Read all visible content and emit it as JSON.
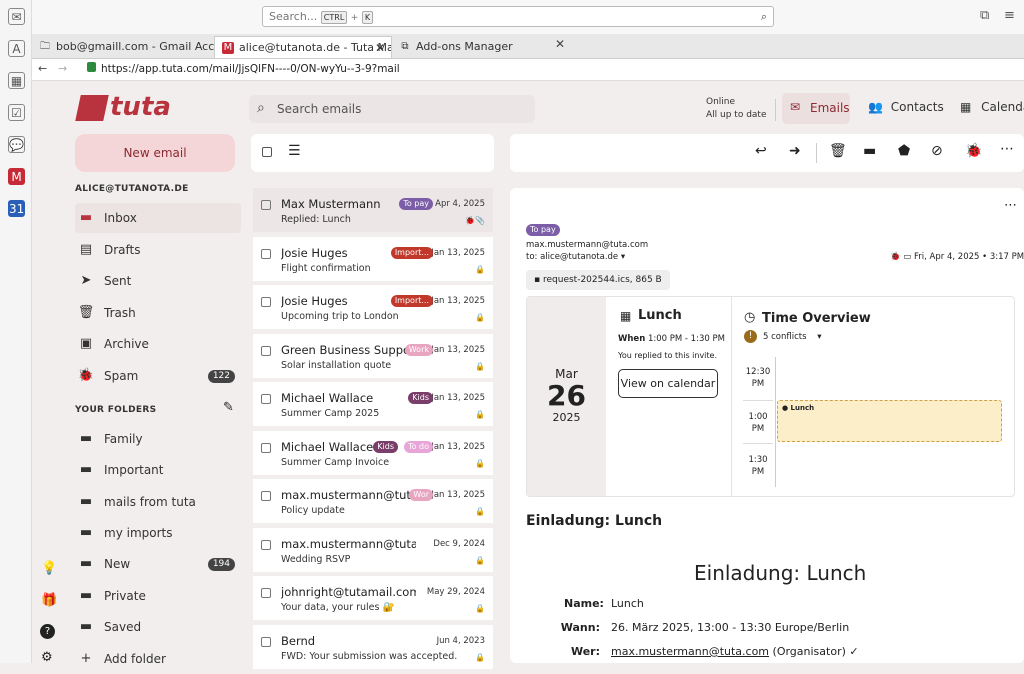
{
  "browser": {
    "search_placeholder": "Search...",
    "search_key1": "CTRL",
    "search_plus": "+",
    "search_key2": "K",
    "tabs": [
      {
        "label": "bob@gmaill.com - Gmail Accou"
      },
      {
        "label": "alice@tutanota.de - Tuta Ma"
      },
      {
        "label": "Add-ons Manager"
      }
    ],
    "url": "https://app.tuta.com/mail/JjsQlFN----0/ON-wyYu--3-9?mail"
  },
  "app": {
    "logo": "tuta",
    "search_placeholder": "Search emails",
    "status_line1": "Online",
    "status_line2": "All up to date",
    "nav": {
      "emails": "Emails",
      "contacts": "Contacts",
      "calendar": "Calendar"
    },
    "new_email": "New email",
    "account": "ALICE@TUTANOTA.DE",
    "folders": [
      {
        "label": "Inbox",
        "icon": "inbox-icon"
      },
      {
        "label": "Drafts",
        "icon": "drafts-icon"
      },
      {
        "label": "Sent",
        "icon": "sent-icon"
      },
      {
        "label": "Trash",
        "icon": "trash-icon"
      },
      {
        "label": "Archive",
        "icon": "archive-icon"
      },
      {
        "label": "Spam",
        "icon": "spam-icon",
        "count": "122"
      }
    ],
    "your_folders": "YOUR FOLDERS",
    "custom_folders": [
      {
        "label": "Family"
      },
      {
        "label": "Important"
      },
      {
        "label": "mails from tuta"
      },
      {
        "label": "my imports"
      },
      {
        "label": "New",
        "count": "194"
      },
      {
        "label": "Private"
      },
      {
        "label": "Saved"
      }
    ],
    "add_folder": "Add folder"
  },
  "emails": [
    {
      "sender": "Max Mustermann",
      "subject": "Replied: Lunch",
      "date": "Apr 4, 2025",
      "labels": [
        {
          "text": "To pay",
          "color": "#7b5ea7"
        }
      ],
      "icons": "🐞📎"
    },
    {
      "sender": "Josie Huges",
      "subject": "Flight confirmation",
      "date": "Jan 13, 2025",
      "labels": [
        {
          "text": "Import...",
          "color": "#c0392b"
        }
      ],
      "icons": "🔒"
    },
    {
      "sender": "Josie Huges",
      "subject": "Upcoming trip to London",
      "date": "Jan 13, 2025",
      "labels": [
        {
          "text": "Import...",
          "color": "#c0392b"
        }
      ],
      "icons": "🔒"
    },
    {
      "sender": "Green Business Support",
      "subject": "Solar installation quote",
      "date": "Jan 13, 2025",
      "labels": [
        {
          "text": "Work",
          "color": "#e8a5c0"
        }
      ],
      "icons": "🔒"
    },
    {
      "sender": "Michael Wallace",
      "subject": "Summer Camp 2025",
      "date": "Jan 13, 2025",
      "labels": [
        {
          "text": "Kids",
          "color": "#7a3e6a"
        }
      ],
      "icons": "🔒"
    },
    {
      "sender": "Michael Wallace",
      "subject": "Summer Camp Invoice",
      "date": "Jan 13, 2025",
      "labels": [
        {
          "text": "Kids",
          "color": "#7a3e6a"
        },
        {
          "text": "To do",
          "color": "#e8a5d8"
        }
      ],
      "icons": "🔒"
    },
    {
      "sender": "max.mustermann@tuta....",
      "subject": "Policy update",
      "date": "Jan 13, 2025",
      "labels": [
        {
          "text": "Wor",
          "color": "#e8a5c0"
        }
      ],
      "icons": "🔒"
    },
    {
      "sender": "max.mustermann@tuta....",
      "subject": "Wedding RSVP",
      "date": "Dec 9, 2024",
      "labels": [],
      "icons": "🔒"
    },
    {
      "sender": "johnright@tutamail.com",
      "subject": "Your data, your rules 🔐",
      "date": "May 29, 2024",
      "labels": [],
      "icons": "🔒"
    },
    {
      "sender": "Bernd",
      "subject": "FWD: Your submission was accepted.",
      "date": "Jun 4, 2023",
      "labels": [],
      "icons": "🔒"
    }
  ],
  "viewer": {
    "label": "To pay",
    "from": "max.mustermann@tuta.com",
    "to": "to: alice@tutanota.de",
    "date": "Fri, Apr 4, 2025 • 3:17 PM",
    "attachment": "request-202544.ics, 865 B",
    "cal_month": "Mar",
    "cal_day": "26",
    "cal_year": "2025",
    "event_title": "Lunch",
    "event_when_label": "When",
    "event_when": "1:00 PM - 1:30 PM",
    "event_replied": "You replied to this invite.",
    "view_calendar": "View on calendar",
    "overview_title": "Time Overview",
    "conflicts": "5 conflicts",
    "times": [
      "12:30 PM",
      "1:00 PM",
      "1:30 PM"
    ],
    "event_block": "Lunch",
    "subject": "Einladung: Lunch",
    "body_title": "Einladung: Lunch",
    "name_label": "Name:",
    "name_value": "Lunch",
    "wann_label": "Wann:",
    "wann_value": "26. März 2025, 13:00 - 13:30 Europe/Berlin",
    "wer_label": "Wer:",
    "wer_link": "max.mustermann@tuta.com",
    "wer_suffix": "(Organisator) ✓"
  }
}
